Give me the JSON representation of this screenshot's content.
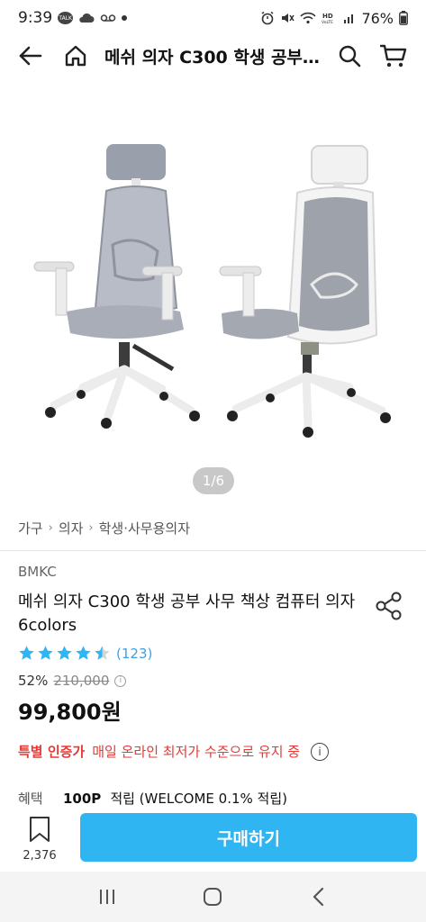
{
  "status_bar": {
    "time": "9:39",
    "talk_label": "TALK",
    "battery": "76%",
    "icons": [
      "talk-icon",
      "cloud-icon",
      "voicemail-icon",
      "dot-icon",
      "alarm-icon",
      "mute-icon",
      "wifi-icon",
      "hd-voice-icon",
      "signal-icon"
    ]
  },
  "app_bar": {
    "title": "메쉬 의자 C300 학생 공부…",
    "icons": [
      "back-arrow-icon",
      "home-icon",
      "search-icon",
      "cart-icon"
    ]
  },
  "gallery": {
    "counter": "1/6"
  },
  "breadcrumb": {
    "items": [
      "가구",
      "의자",
      "학생·사무용의자"
    ]
  },
  "product": {
    "brand": "BMKC",
    "title": "메쉬 의자 C300 학생 공부 사무 책상 컴퓨터 의자 6colors",
    "rating": 4.5,
    "review_count": "(123)",
    "discount": "52%",
    "original_price": "210,000",
    "sale_price": "99,800원"
  },
  "certification": {
    "badge": "특별 인증가",
    "text": "매일 온라인 최저가 수준으로 유지 중"
  },
  "benefit": {
    "label": "혜택",
    "points": "100P",
    "text": "적립 (WELCOME 0.1% 적립)"
  },
  "buy_bar": {
    "wish_count": "2,376",
    "buy_label": "구매하기"
  },
  "colors": {
    "accent": "#2fb5f2",
    "star": "#2fb5f2",
    "alert": "#e53935"
  }
}
